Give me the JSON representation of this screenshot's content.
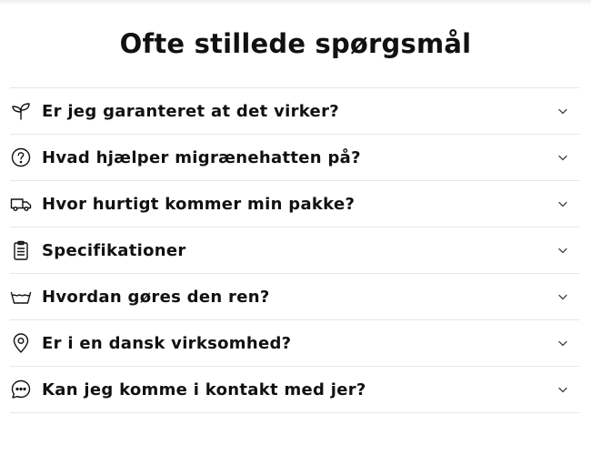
{
  "faq": {
    "title": "Ofte stillede spørgsmål",
    "items": [
      {
        "icon": "sprout-icon",
        "label": "Er jeg garanteret at det virker?"
      },
      {
        "icon": "question-circle-icon",
        "label": "Hvad hjælper migrænehatten på?"
      },
      {
        "icon": "truck-icon",
        "label": "Hvor hurtigt kommer min pakke?"
      },
      {
        "icon": "clipboard-icon",
        "label": "Specifikationer"
      },
      {
        "icon": "wash-basin-icon",
        "label": "Hvordan gøres den ren?"
      },
      {
        "icon": "map-pin-icon",
        "label": "Er i en dansk virksomhed?"
      },
      {
        "icon": "chat-bubble-icon",
        "label": "Kan jeg komme i kontakt med jer?"
      }
    ]
  }
}
